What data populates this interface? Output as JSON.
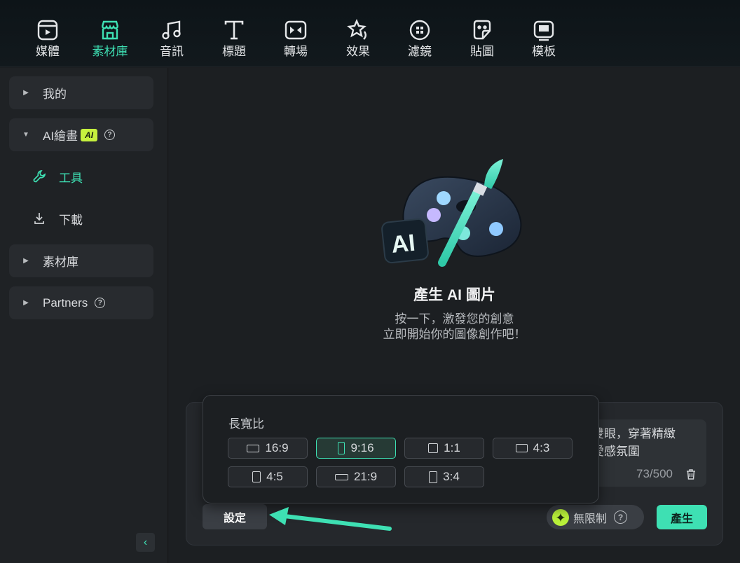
{
  "toolbar": {
    "items": [
      {
        "label": "媒體",
        "icon": "media-icon",
        "active": false
      },
      {
        "label": "素材庫",
        "icon": "store-icon",
        "active": true
      },
      {
        "label": "音訊",
        "icon": "music-icon",
        "active": false
      },
      {
        "label": "標題",
        "icon": "title-icon",
        "active": false
      },
      {
        "label": "轉場",
        "icon": "transition-icon",
        "active": false
      },
      {
        "label": "效果",
        "icon": "effects-icon",
        "active": false
      },
      {
        "label": "濾鏡",
        "icon": "filter-icon",
        "active": false
      },
      {
        "label": "貼圖",
        "icon": "sticker-icon",
        "active": false
      },
      {
        "label": "模板",
        "icon": "template-icon",
        "active": false
      }
    ]
  },
  "sidebar": {
    "my": "我的",
    "ai_painting": "AI繪畫",
    "ai_badge": "AI",
    "tools": "工具",
    "download": "下載",
    "library": "素材庫",
    "partners": "Partners"
  },
  "hero": {
    "art_badge": "AI",
    "title": "產生 AI 圖片",
    "desc_line1": "按一下，激發您的創意",
    "desc_line2": "立即開始你的圖像創作吧！"
  },
  "prompt": {
    "line1": "色雙眼，穿著精緻",
    "line2": "戀愛感氛圍",
    "char_count": "73/500"
  },
  "aspect_ratio": {
    "title": "長寬比",
    "options": [
      "16:9",
      "9:16",
      "1:1",
      "4:3",
      "4:5",
      "21:9",
      "3:4"
    ],
    "selected": "9:16"
  },
  "actions": {
    "settings": "設定",
    "unlimited": "無限制",
    "generate": "產生"
  },
  "colors": {
    "accent": "#3ee0b3",
    "ai_badge": "#c6f13e"
  }
}
